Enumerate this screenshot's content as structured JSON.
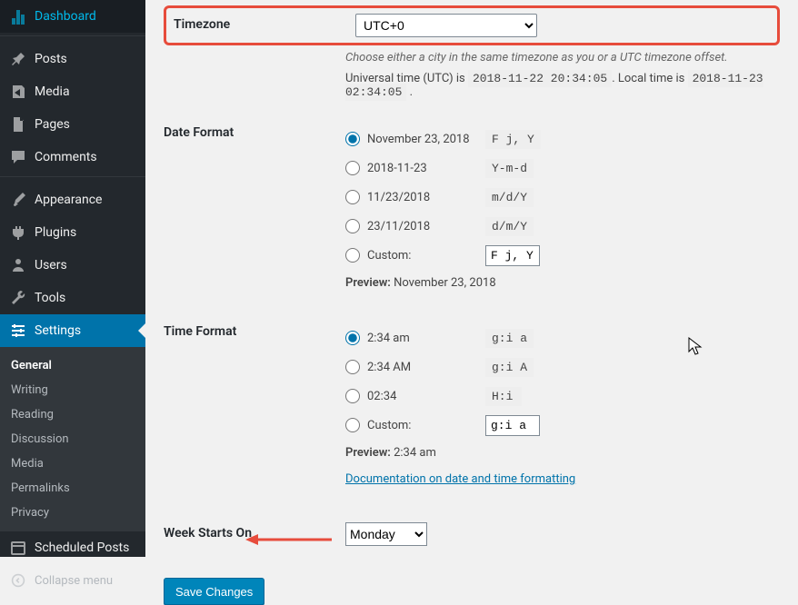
{
  "sidebar": {
    "items": [
      {
        "label": "Dashboard"
      },
      {
        "label": "Posts"
      },
      {
        "label": "Media"
      },
      {
        "label": "Pages"
      },
      {
        "label": "Comments"
      },
      {
        "label": "Appearance"
      },
      {
        "label": "Plugins"
      },
      {
        "label": "Users"
      },
      {
        "label": "Tools"
      },
      {
        "label": "Settings"
      }
    ],
    "submenu": [
      {
        "label": "General"
      },
      {
        "label": "Writing"
      },
      {
        "label": "Reading"
      },
      {
        "label": "Discussion"
      },
      {
        "label": "Media"
      },
      {
        "label": "Permalinks"
      },
      {
        "label": "Privacy"
      }
    ],
    "scheduled": "Scheduled Posts",
    "collapse": "Collapse menu"
  },
  "timezone": {
    "label": "Timezone",
    "value": "UTC+0",
    "description": "Choose either a city in the same timezone as you or a UTC timezone offset.",
    "utc_prefix": "Universal time (UTC) is ",
    "utc_value": "2018-11-22 20:34:05",
    "local_prefix": ". Local time is ",
    "local_value": "2018-11-23 02:34:05",
    "suffix": " ."
  },
  "date_format": {
    "label": "Date Format",
    "options": [
      {
        "example": "November 23, 2018",
        "code": "F j, Y"
      },
      {
        "example": "2018-11-23",
        "code": "Y-m-d"
      },
      {
        "example": "11/23/2018",
        "code": "m/d/Y"
      },
      {
        "example": "23/11/2018",
        "code": "d/m/Y"
      }
    ],
    "custom_label": "Custom:",
    "custom_value": "F j, Y",
    "preview_label": "Preview:",
    "preview_value": "November 23, 2018"
  },
  "time_format": {
    "label": "Time Format",
    "options": [
      {
        "example": "2:34 am",
        "code": "g:i a"
      },
      {
        "example": "2:34 AM",
        "code": "g:i A"
      },
      {
        "example": "02:34",
        "code": "H:i"
      }
    ],
    "custom_label": "Custom:",
    "custom_value": "g:i a",
    "preview_label": "Preview:",
    "preview_value": "2:34 am",
    "doc_link": "Documentation on date and time formatting"
  },
  "week": {
    "label": "Week Starts On",
    "value": "Monday"
  },
  "save": "Save Changes"
}
